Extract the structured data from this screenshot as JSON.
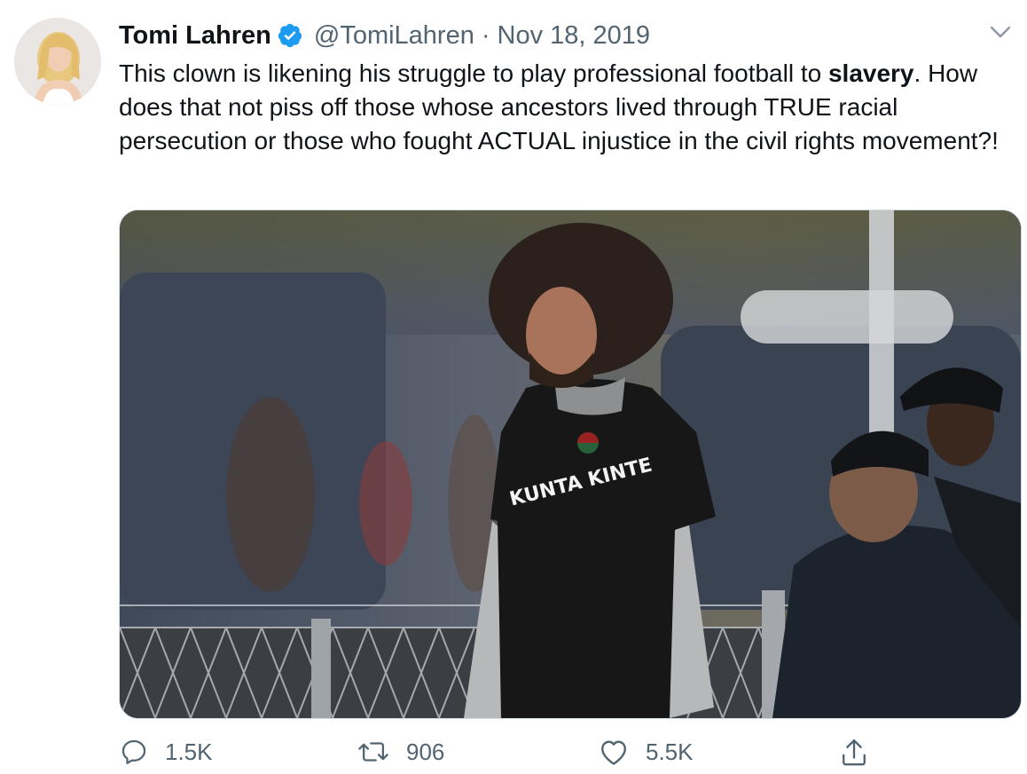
{
  "tweet": {
    "display_name": "Tomi Lahren",
    "handle": "@TomiLahren",
    "separator": "·",
    "date": "Nov 18, 2019",
    "text_before": "This clown is likening his struggle to play professional football to ",
    "text_bold": "slavery",
    "text_after": ". How does that not piss off those whose ancestors lived through TRUE racial persecution or those who fought ACTUAL injustice in the civil rights movement?!",
    "media": {
      "shirt_text": "KUNTA KINTE"
    }
  },
  "actions": {
    "reply_count": "1.5K",
    "retweet_count": "906",
    "like_count": "5.5K"
  },
  "icons": {
    "verified": "verified-badge-icon",
    "menu": "chevron-down-icon",
    "reply": "reply-icon",
    "retweet": "retweet-icon",
    "like": "heart-icon",
    "share": "share-icon"
  },
  "colors": {
    "text": "#0f1419",
    "secondary": "#536471",
    "verified": "#1d9bf0",
    "border": "#cfd9de"
  }
}
